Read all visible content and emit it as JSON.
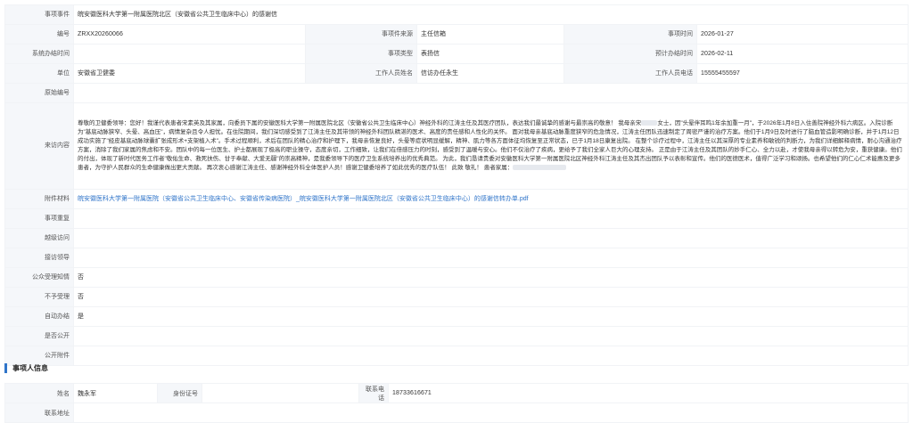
{
  "event": {
    "labels": {
      "title": "事项事件",
      "code": "编号",
      "source": "事项件来源",
      "time": "事项时间",
      "sys_time": "系统办结时间",
      "type": "事项类型",
      "due": "预计办结时间",
      "unit": "单位",
      "staff": "工作人员姓名",
      "phone": "工作人员电话",
      "orig_code": "原始编号",
      "content": "来访内容",
      "attachment": "附件材料",
      "repeat": "事项重复",
      "overstep": "越级访问",
      "guide": "接访领导",
      "public_accept": "公众受理知情",
      "not_accept": "不予受理",
      "auto_close": "自动办结",
      "is_public": "是否公开",
      "public_attachment": "公开附件"
    },
    "title": "皖安徽医科大学第一附属医院北区（安徽省公共卫生临床中心）的感谢信",
    "code": "ZRXX20260066",
    "source": "主任信箱",
    "time": "2026-01-27",
    "sys_time": "",
    "type": "表扬信",
    "due": "2026-02-11",
    "unit": "安徽省卫健委",
    "staff": "信访办任永生",
    "phone": "15555455597",
    "orig_code": "",
    "content_a": "尊敬的卫健委领导：您好！我谨代表患者宋素英及其家属，向委员下属的安徽医科大学第一附属医院北区（安徽省公共卫生临床中心）神经外科的江涛主任及其医疗团队，表达我们最诚挚的感谢与最崇高的敬意！ 我母亲宋",
    "content_b": "女士，因\"头晕伴耳鸣1年余加重一月\"，于2026年1月8日入住善院神经外科六病区。入院诊断为\"基底动脉狭窄、头晕、高血压\"，病情复杂且令人担忧。在住院期间，我们深切感受到了江涛主任及其带领的神经外科团队精湛的医术、高度的责任感和人性化的关怀。 面对我母亲基底动脉重度狭窄的危急情况，江涛主任团队迅速制定了周密严谨的治疗方案。他们于1月9日及时进行了脑血管造影明确诊断，并于1月12日成功实施了\"经皮基底动脉球囊扩张成形术+支架植入术\"。手术过程顺利，术后在团队的精心治疗和护理下，我母亲恢复良好，头晕等症状明显缓解，精神、肌力等各方面体征均恢复至正常状态，已于1月18日康复出院。 在整个诊疗过程中，江涛主任以其深厚的专业素养和敏锐的判断力，为我们详细解释病情，耐心沟通治疗方案，消除了我们家属的焦虑和不安。团队中的每一位医生、护士都展现了极高的职业操守，态度亲切，工作细致，让我们在倍感压力的时刻，感受到了温暖与安心。他们不仅治疗了疾病，更给予了我们全家人巨大的心理支持。 正是由于江涛主任及其团队的妙手仁心、全力以赴，才使我母亲得以转危为安，重获健康。他们的付出，体现了新时代医务工作者\"敬佑生命、救死扶伤、甘于奉献、大爱无疆\"的崇高精神，是我委领导下的医疗卫生系统培养出的优秀典范。 为此，我们恳请贵委对安徽医科大学第一附属医院北区神经外科江涛主任及其杰出团队予以表彰和宣传。他们的医德医术，值得广泛学习和颂扬。也希望他们的仁心仁术能惠及更多患者，为守护人民群众的生命健康做出更大贡献。 再次衷心感谢江涛主任、感谢神经外科全体医护人员！感谢卫健委培养了如此优秀的医疗队伍！ 此致 敬礼！ 患者家属：",
    "attachment": "皖安徽医科大学第一附属医院（安徽省公共卫生临床中心、安徽省传染病医院）_皖安徽医科大学第一附属医院北区（安徽省公共卫生临床中心）的感谢信转办单.pdf",
    "repeat": "",
    "overstep": "",
    "guide": "",
    "public_accept": "否",
    "not_accept": "否",
    "auto_close": "是",
    "is_public": "",
    "public_attachment": ""
  },
  "person_section": {
    "title": "事项人信息",
    "labels": {
      "name": "姓名",
      "id": "身份证号",
      "phone": "联系电话",
      "address": "联系地址"
    },
    "name": "魏永军",
    "id": "",
    "phone": "18733616671",
    "address": ""
  },
  "colors": {
    "accent": "#2f74c9",
    "label_bg": "#f5f7fa",
    "border": "#f1f3f6"
  }
}
